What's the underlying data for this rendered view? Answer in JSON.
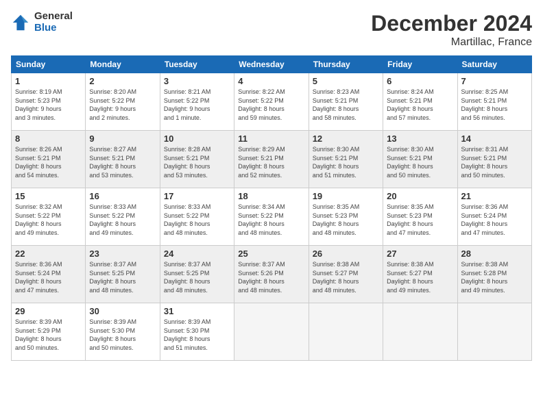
{
  "logo": {
    "general": "General",
    "blue": "Blue"
  },
  "title": {
    "month": "December 2024",
    "location": "Martillac, France"
  },
  "days_header": [
    "Sunday",
    "Monday",
    "Tuesday",
    "Wednesday",
    "Thursday",
    "Friday",
    "Saturday"
  ],
  "weeks": [
    {
      "shaded": false,
      "days": [
        {
          "num": "1",
          "info": "Sunrise: 8:19 AM\nSunset: 5:23 PM\nDaylight: 9 hours\nand 3 minutes."
        },
        {
          "num": "2",
          "info": "Sunrise: 8:20 AM\nSunset: 5:22 PM\nDaylight: 9 hours\nand 2 minutes."
        },
        {
          "num": "3",
          "info": "Sunrise: 8:21 AM\nSunset: 5:22 PM\nDaylight: 9 hours\nand 1 minute."
        },
        {
          "num": "4",
          "info": "Sunrise: 8:22 AM\nSunset: 5:22 PM\nDaylight: 8 hours\nand 59 minutes."
        },
        {
          "num": "5",
          "info": "Sunrise: 8:23 AM\nSunset: 5:21 PM\nDaylight: 8 hours\nand 58 minutes."
        },
        {
          "num": "6",
          "info": "Sunrise: 8:24 AM\nSunset: 5:21 PM\nDaylight: 8 hours\nand 57 minutes."
        },
        {
          "num": "7",
          "info": "Sunrise: 8:25 AM\nSunset: 5:21 PM\nDaylight: 8 hours\nand 56 minutes."
        }
      ]
    },
    {
      "shaded": true,
      "days": [
        {
          "num": "8",
          "info": "Sunrise: 8:26 AM\nSunset: 5:21 PM\nDaylight: 8 hours\nand 54 minutes."
        },
        {
          "num": "9",
          "info": "Sunrise: 8:27 AM\nSunset: 5:21 PM\nDaylight: 8 hours\nand 53 minutes."
        },
        {
          "num": "10",
          "info": "Sunrise: 8:28 AM\nSunset: 5:21 PM\nDaylight: 8 hours\nand 53 minutes."
        },
        {
          "num": "11",
          "info": "Sunrise: 8:29 AM\nSunset: 5:21 PM\nDaylight: 8 hours\nand 52 minutes."
        },
        {
          "num": "12",
          "info": "Sunrise: 8:30 AM\nSunset: 5:21 PM\nDaylight: 8 hours\nand 51 minutes."
        },
        {
          "num": "13",
          "info": "Sunrise: 8:30 AM\nSunset: 5:21 PM\nDaylight: 8 hours\nand 50 minutes."
        },
        {
          "num": "14",
          "info": "Sunrise: 8:31 AM\nSunset: 5:21 PM\nDaylight: 8 hours\nand 50 minutes."
        }
      ]
    },
    {
      "shaded": false,
      "days": [
        {
          "num": "15",
          "info": "Sunrise: 8:32 AM\nSunset: 5:22 PM\nDaylight: 8 hours\nand 49 minutes."
        },
        {
          "num": "16",
          "info": "Sunrise: 8:33 AM\nSunset: 5:22 PM\nDaylight: 8 hours\nand 49 minutes."
        },
        {
          "num": "17",
          "info": "Sunrise: 8:33 AM\nSunset: 5:22 PM\nDaylight: 8 hours\nand 48 minutes."
        },
        {
          "num": "18",
          "info": "Sunrise: 8:34 AM\nSunset: 5:22 PM\nDaylight: 8 hours\nand 48 minutes."
        },
        {
          "num": "19",
          "info": "Sunrise: 8:35 AM\nSunset: 5:23 PM\nDaylight: 8 hours\nand 48 minutes."
        },
        {
          "num": "20",
          "info": "Sunrise: 8:35 AM\nSunset: 5:23 PM\nDaylight: 8 hours\nand 47 minutes."
        },
        {
          "num": "21",
          "info": "Sunrise: 8:36 AM\nSunset: 5:24 PM\nDaylight: 8 hours\nand 47 minutes."
        }
      ]
    },
    {
      "shaded": true,
      "days": [
        {
          "num": "22",
          "info": "Sunrise: 8:36 AM\nSunset: 5:24 PM\nDaylight: 8 hours\nand 47 minutes."
        },
        {
          "num": "23",
          "info": "Sunrise: 8:37 AM\nSunset: 5:25 PM\nDaylight: 8 hours\nand 48 minutes."
        },
        {
          "num": "24",
          "info": "Sunrise: 8:37 AM\nSunset: 5:25 PM\nDaylight: 8 hours\nand 48 minutes."
        },
        {
          "num": "25",
          "info": "Sunrise: 8:37 AM\nSunset: 5:26 PM\nDaylight: 8 hours\nand 48 minutes."
        },
        {
          "num": "26",
          "info": "Sunrise: 8:38 AM\nSunset: 5:27 PM\nDaylight: 8 hours\nand 48 minutes."
        },
        {
          "num": "27",
          "info": "Sunrise: 8:38 AM\nSunset: 5:27 PM\nDaylight: 8 hours\nand 49 minutes."
        },
        {
          "num": "28",
          "info": "Sunrise: 8:38 AM\nSunset: 5:28 PM\nDaylight: 8 hours\nand 49 minutes."
        }
      ]
    },
    {
      "shaded": false,
      "days": [
        {
          "num": "29",
          "info": "Sunrise: 8:39 AM\nSunset: 5:29 PM\nDaylight: 8 hours\nand 50 minutes."
        },
        {
          "num": "30",
          "info": "Sunrise: 8:39 AM\nSunset: 5:30 PM\nDaylight: 8 hours\nand 50 minutes."
        },
        {
          "num": "31",
          "info": "Sunrise: 8:39 AM\nSunset: 5:30 PM\nDaylight: 8 hours\nand 51 minutes."
        },
        {
          "num": "",
          "info": ""
        },
        {
          "num": "",
          "info": ""
        },
        {
          "num": "",
          "info": ""
        },
        {
          "num": "",
          "info": ""
        }
      ]
    }
  ]
}
